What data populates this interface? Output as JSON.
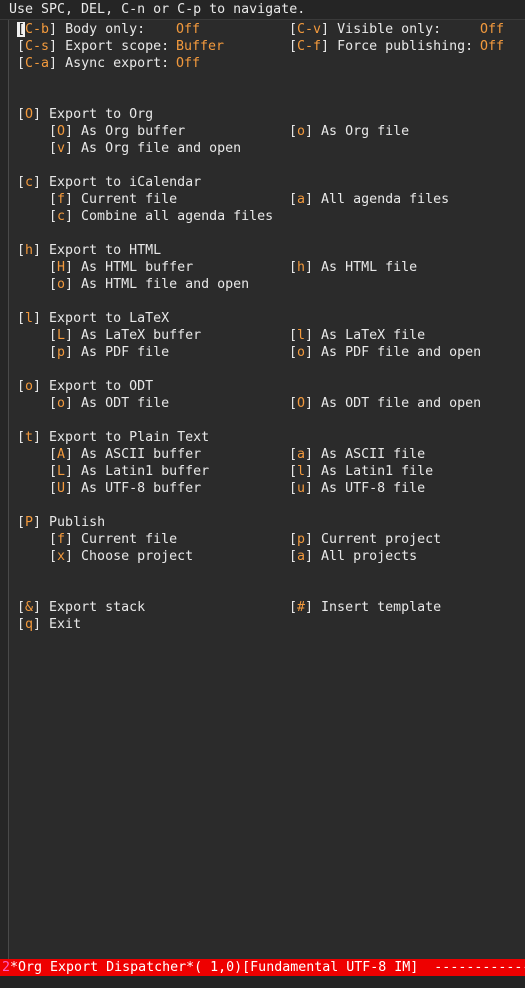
{
  "hint": "Use SPC, DEL, C-n or C-p to navigate.",
  "options": {
    "body_only": {
      "key": "C-b",
      "label": "Body only:",
      "value": "Off"
    },
    "visible_only": {
      "key": "C-v",
      "label": "Visible only:",
      "value": "Off"
    },
    "export_scope": {
      "key": "C-s",
      "label": "Export scope:",
      "value": "Buffer"
    },
    "force_publishing": {
      "key": "C-f",
      "label": "Force publishing:",
      "value": "Off"
    },
    "async_export": {
      "key": "C-a",
      "label": "Async export:",
      "value": "Off"
    }
  },
  "org": {
    "key": "O",
    "title": "Export to Org",
    "items": [
      {
        "key": "O",
        "label": "As Org buffer"
      },
      {
        "key": "o",
        "label": "As Org file"
      },
      {
        "key": "v",
        "label": "As Org file and open"
      }
    ]
  },
  "icalendar": {
    "key": "c",
    "title": "Export to iCalendar",
    "items": [
      {
        "key": "f",
        "label": "Current file"
      },
      {
        "key": "a",
        "label": "All agenda files"
      },
      {
        "key": "c",
        "label": "Combine all agenda files"
      }
    ]
  },
  "html": {
    "key": "h",
    "title": "Export to HTML",
    "items": [
      {
        "key": "H",
        "label": "As HTML buffer"
      },
      {
        "key": "h",
        "label": "As HTML file"
      },
      {
        "key": "o",
        "label": "As HTML file and open"
      }
    ]
  },
  "latex": {
    "key": "l",
    "title": "Export to LaTeX",
    "items": [
      {
        "key": "L",
        "label": "As LaTeX buffer"
      },
      {
        "key": "l",
        "label": "As LaTeX file"
      },
      {
        "key": "p",
        "label": "As PDF file"
      },
      {
        "key": "o",
        "label": "As PDF file and open"
      }
    ]
  },
  "odt": {
    "key": "o",
    "title": "Export to ODT",
    "items": [
      {
        "key": "o",
        "label": "As ODT file"
      },
      {
        "key": "O",
        "label": "As ODT file and open"
      }
    ]
  },
  "plain": {
    "key": "t",
    "title": "Export to Plain Text",
    "items": [
      {
        "key": "A",
        "label": "As ASCII buffer"
      },
      {
        "key": "a",
        "label": "As ASCII file"
      },
      {
        "key": "L",
        "label": "As Latin1 buffer"
      },
      {
        "key": "l",
        "label": "As Latin1 file"
      },
      {
        "key": "U",
        "label": "As UTF-8 buffer"
      },
      {
        "key": "u",
        "label": "As UTF-8 file"
      }
    ]
  },
  "publish": {
    "key": "P",
    "title": "Publish",
    "items": [
      {
        "key": "f",
        "label": "Current file"
      },
      {
        "key": "p",
        "label": "Current project"
      },
      {
        "key": "x",
        "label": "Choose project"
      },
      {
        "key": "a",
        "label": "All projects"
      }
    ]
  },
  "stack": {
    "key": "&",
    "label": "Export stack"
  },
  "template": {
    "key": "#",
    "label": "Insert template"
  },
  "exit": {
    "key": "q",
    "label": "Exit"
  },
  "modeline": {
    "flag": "2",
    "text": "*Org Export Dispatcher*( 1,0)[Fundamental UTF-8 IM]  --------------------"
  },
  "colors": {
    "key": "#f39a3d",
    "modeline": "#ee0000",
    "background": "#2b2b2b"
  }
}
